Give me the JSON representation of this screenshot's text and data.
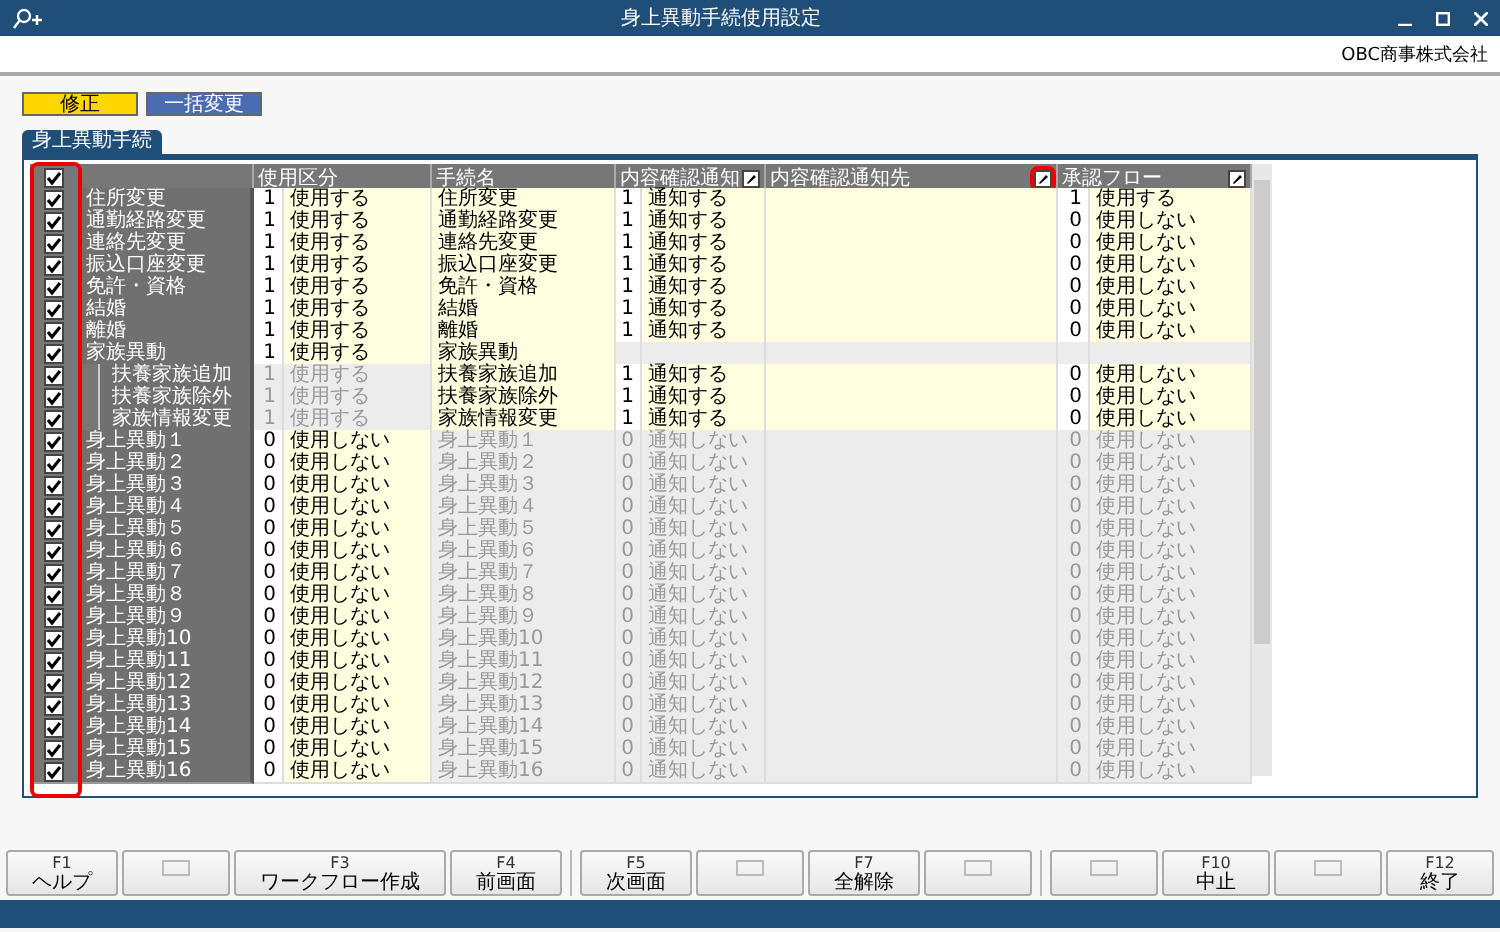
{
  "window": {
    "title": "身上異動手続使用設定"
  },
  "company": "OBC商事株式会社",
  "toolbar": [
    {
      "label": "修正",
      "kind": "edit"
    },
    {
      "label": "一括変更",
      "kind": "bulk"
    }
  ],
  "tab": {
    "label": "身上異動手続",
    "selected": true
  },
  "grid": {
    "select_all_checked": true,
    "checkbox_column_highlighted": true,
    "columns": [
      {
        "label": "使用区分"
      },
      {
        "label": "手続名"
      },
      {
        "label": "内容確認通知",
        "highlighted": false
      },
      {
        "label": "内容確認通知先",
        "highlighted": true
      },
      {
        "label": "承認フロー",
        "highlighted": false
      }
    ],
    "rows": [
      {
        "checked": true,
        "name": "住所変更",
        "use_code": "1",
        "use": "使用する",
        "procedure": "住所変更",
        "notify_code": "1",
        "notify": "通知する",
        "flow_code": "1",
        "flow": "使用する",
        "active": true
      },
      {
        "checked": true,
        "name": "通勤経路変更",
        "use_code": "1",
        "use": "使用する",
        "procedure": "通勤経路変更",
        "notify_code": "1",
        "notify": "通知する",
        "flow_code": "0",
        "flow": "使用しない",
        "active": true
      },
      {
        "checked": true,
        "name": "連絡先変更",
        "use_code": "1",
        "use": "使用する",
        "procedure": "連絡先変更",
        "notify_code": "1",
        "notify": "通知する",
        "flow_code": "0",
        "flow": "使用しない",
        "active": true
      },
      {
        "checked": true,
        "name": "振込口座変更",
        "use_code": "1",
        "use": "使用する",
        "procedure": "振込口座変更",
        "notify_code": "1",
        "notify": "通知する",
        "flow_code": "0",
        "flow": "使用しない",
        "active": true
      },
      {
        "checked": true,
        "name": "免許・資格",
        "use_code": "1",
        "use": "使用する",
        "procedure": "免許・資格",
        "notify_code": "1",
        "notify": "通知する",
        "flow_code": "0",
        "flow": "使用しない",
        "active": true
      },
      {
        "checked": true,
        "name": "結婚",
        "use_code": "1",
        "use": "使用する",
        "procedure": "結婚",
        "notify_code": "1",
        "notify": "通知する",
        "flow_code": "0",
        "flow": "使用しない",
        "active": true
      },
      {
        "checked": true,
        "name": "離婚",
        "use_code": "1",
        "use": "使用する",
        "procedure": "離婚",
        "notify_code": "1",
        "notify": "通知する",
        "flow_code": "0",
        "flow": "使用しない",
        "active": true
      },
      {
        "checked": true,
        "name": "家族異動",
        "use_code": "1",
        "use": "使用する",
        "procedure": "家族異動",
        "active": true,
        "children": [
          {
            "checked": true,
            "name": "扶養家族追加",
            "use_code": "1",
            "use": "使用する",
            "use_locked": true,
            "procedure": "扶養家族追加",
            "notify_code": "1",
            "notify": "通知する",
            "flow_code": "0",
            "flow": "使用しない",
            "active": true
          },
          {
            "checked": true,
            "name": "扶養家族除外",
            "use_code": "1",
            "use": "使用する",
            "use_locked": true,
            "procedure": "扶養家族除外",
            "notify_code": "1",
            "notify": "通知する",
            "flow_code": "0",
            "flow": "使用しない",
            "active": true
          },
          {
            "checked": true,
            "name": "家族情報変更",
            "use_code": "1",
            "use": "使用する",
            "use_locked": true,
            "procedure": "家族情報変更",
            "notify_code": "1",
            "notify": "通知する",
            "flow_code": "0",
            "flow": "使用しない",
            "active": true
          }
        ]
      },
      {
        "checked": true,
        "name": "身上異動１",
        "use_code": "0",
        "use": "使用しない",
        "procedure": "身上異動１",
        "notify_code": "0",
        "notify": "通知しない",
        "flow_code": "0",
        "flow": "使用しない",
        "active": false
      },
      {
        "checked": true,
        "name": "身上異動２",
        "use_code": "0",
        "use": "使用しない",
        "procedure": "身上異動２",
        "notify_code": "0",
        "notify": "通知しない",
        "flow_code": "0",
        "flow": "使用しない",
        "active": false
      },
      {
        "checked": true,
        "name": "身上異動３",
        "use_code": "0",
        "use": "使用しない",
        "procedure": "身上異動３",
        "notify_code": "0",
        "notify": "通知しない",
        "flow_code": "0",
        "flow": "使用しない",
        "active": false
      },
      {
        "checked": true,
        "name": "身上異動４",
        "use_code": "0",
        "use": "使用しない",
        "procedure": "身上異動４",
        "notify_code": "0",
        "notify": "通知しない",
        "flow_code": "0",
        "flow": "使用しない",
        "active": false
      },
      {
        "checked": true,
        "name": "身上異動５",
        "use_code": "0",
        "use": "使用しない",
        "procedure": "身上異動５",
        "notify_code": "0",
        "notify": "通知しない",
        "flow_code": "0",
        "flow": "使用しない",
        "active": false
      },
      {
        "checked": true,
        "name": "身上異動６",
        "use_code": "0",
        "use": "使用しない",
        "procedure": "身上異動６",
        "notify_code": "0",
        "notify": "通知しない",
        "flow_code": "0",
        "flow": "使用しない",
        "active": false
      },
      {
        "checked": true,
        "name": "身上異動７",
        "use_code": "0",
        "use": "使用しない",
        "procedure": "身上異動７",
        "notify_code": "0",
        "notify": "通知しない",
        "flow_code": "0",
        "flow": "使用しない",
        "active": false
      },
      {
        "checked": true,
        "name": "身上異動８",
        "use_code": "0",
        "use": "使用しない",
        "procedure": "身上異動８",
        "notify_code": "0",
        "notify": "通知しない",
        "flow_code": "0",
        "flow": "使用しない",
        "active": false
      },
      {
        "checked": true,
        "name": "身上異動９",
        "use_code": "0",
        "use": "使用しない",
        "procedure": "身上異動９",
        "notify_code": "0",
        "notify": "通知しない",
        "flow_code": "0",
        "flow": "使用しない",
        "active": false
      },
      {
        "checked": true,
        "name": "身上異動10",
        "use_code": "0",
        "use": "使用しない",
        "procedure": "身上異動10",
        "notify_code": "0",
        "notify": "通知しない",
        "flow_code": "0",
        "flow": "使用しない",
        "active": false
      },
      {
        "checked": true,
        "name": "身上異動11",
        "use_code": "0",
        "use": "使用しない",
        "procedure": "身上異動11",
        "notify_code": "0",
        "notify": "通知しない",
        "flow_code": "0",
        "flow": "使用しない",
        "active": false
      },
      {
        "checked": true,
        "name": "身上異動12",
        "use_code": "0",
        "use": "使用しない",
        "procedure": "身上異動12",
        "notify_code": "0",
        "notify": "通知しない",
        "flow_code": "0",
        "flow": "使用しない",
        "active": false
      },
      {
        "checked": true,
        "name": "身上異動13",
        "use_code": "0",
        "use": "使用しない",
        "procedure": "身上異動13",
        "notify_code": "0",
        "notify": "通知しない",
        "flow_code": "0",
        "flow": "使用しない",
        "active": false
      },
      {
        "checked": true,
        "name": "身上異動14",
        "use_code": "0",
        "use": "使用しない",
        "procedure": "身上異動14",
        "notify_code": "0",
        "notify": "通知しない",
        "flow_code": "0",
        "flow": "使用しない",
        "active": false
      },
      {
        "checked": true,
        "name": "身上異動15",
        "use_code": "0",
        "use": "使用しない",
        "procedure": "身上異動15",
        "notify_code": "0",
        "notify": "通知しない",
        "flow_code": "0",
        "flow": "使用しない",
        "active": false
      },
      {
        "checked": true,
        "name": "身上異動16",
        "use_code": "0",
        "use": "使用しない",
        "procedure": "身上異動16",
        "notify_code": "0",
        "notify": "通知しない",
        "flow_code": "0",
        "flow": "使用しない",
        "active": false
      }
    ]
  },
  "function_keys": [
    {
      "kind": "key",
      "key": "F1",
      "label": "ヘルプ"
    },
    {
      "kind": "blank"
    },
    {
      "kind": "key",
      "key": "F3",
      "label": "ワークフロー作成"
    },
    {
      "kind": "key",
      "key": "F4",
      "label": "前画面"
    },
    {
      "kind": "key",
      "key": "F5",
      "label": "次画面"
    },
    {
      "kind": "blank"
    },
    {
      "kind": "key",
      "key": "F7",
      "label": "全解除"
    },
    {
      "kind": "blank"
    },
    {
      "kind": "blank"
    },
    {
      "kind": "key",
      "key": "F10",
      "label": "中止"
    },
    {
      "kind": "blank"
    },
    {
      "kind": "key",
      "key": "F12",
      "label": "終了"
    }
  ]
}
